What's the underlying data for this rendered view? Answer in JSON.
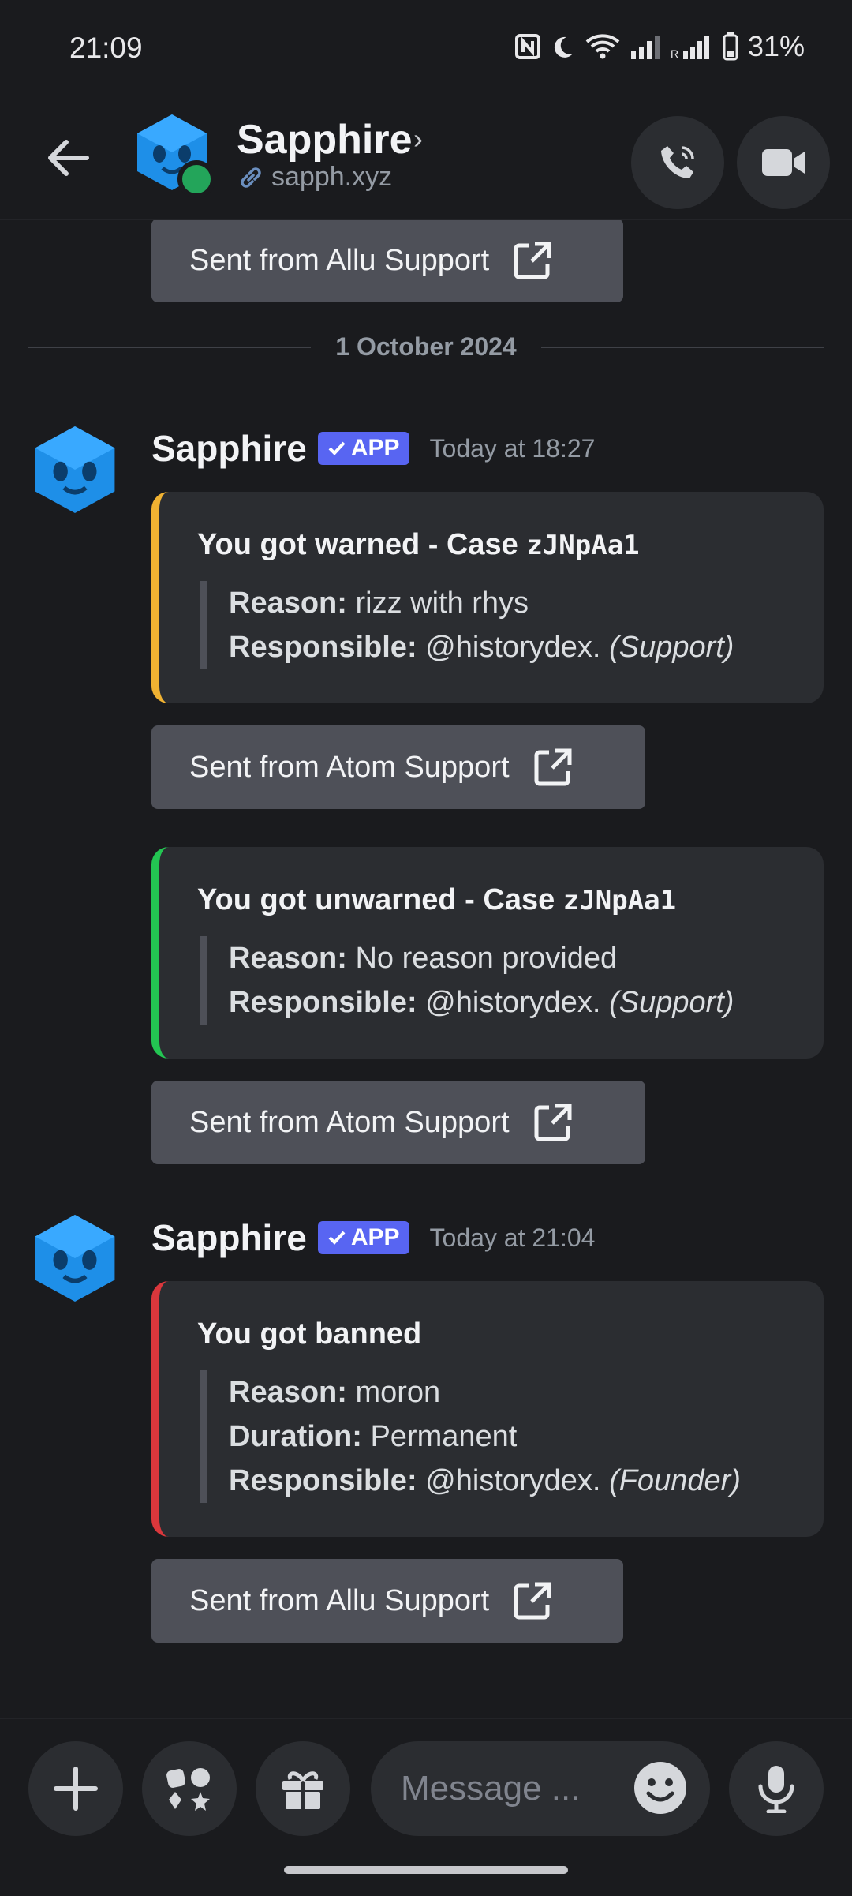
{
  "status_bar": {
    "time": "21:09",
    "battery": "31%"
  },
  "header": {
    "title": "Sapphire",
    "subtitle": "sapph.xyz"
  },
  "top_link": {
    "label": "Sent from Allu Support"
  },
  "date_divider": "1 October 2024",
  "messages": [
    {
      "author": "Sapphire",
      "badge": "APP",
      "timestamp": "Today at 18:27",
      "embeds": [
        {
          "title_prefix": "You got warned - Case ",
          "case_code": "zJNpAa1",
          "accent_color": "#f0b232",
          "fields": [
            {
              "label": "Reason:",
              "value": "rizz with rhys"
            },
            {
              "label": "Responsible:",
              "value": "@historydex.",
              "role": "(Support)"
            }
          ],
          "link": "Sent from Atom Support"
        },
        {
          "title_prefix": "You got unwarned - Case ",
          "case_code": "zJNpAa1",
          "accent_color": "#23c552",
          "fields": [
            {
              "label": "Reason:",
              "value": "No reason provided"
            },
            {
              "label": "Responsible:",
              "value": "@historydex.",
              "role": "(Support)"
            }
          ],
          "link": "Sent from Atom Support"
        }
      ]
    },
    {
      "author": "Sapphire",
      "badge": "APP",
      "timestamp": "Today at 21:04",
      "embeds": [
        {
          "title_prefix": "You got banned",
          "accent_color": "#da373c",
          "fields": [
            {
              "label": "Reason:",
              "value": "moron"
            },
            {
              "label": "Duration:",
              "value": "Permanent"
            },
            {
              "label": "Responsible:",
              "value": "@historydex.",
              "role": "(Founder)"
            }
          ],
          "link": "Sent from Allu Support"
        }
      ]
    }
  ],
  "composer": {
    "placeholder": "Message ..."
  },
  "icons": {
    "back": "arrow-left-icon",
    "call": "phone-icon",
    "video": "video-camera-icon",
    "plus": "plus-icon",
    "apps": "apps-icon",
    "gift": "gift-icon",
    "emoji": "emoji-icon",
    "mic": "microphone-icon",
    "external": "external-link-icon"
  },
  "colors": {
    "brand": "#5865f2",
    "online": "#23a55a"
  }
}
